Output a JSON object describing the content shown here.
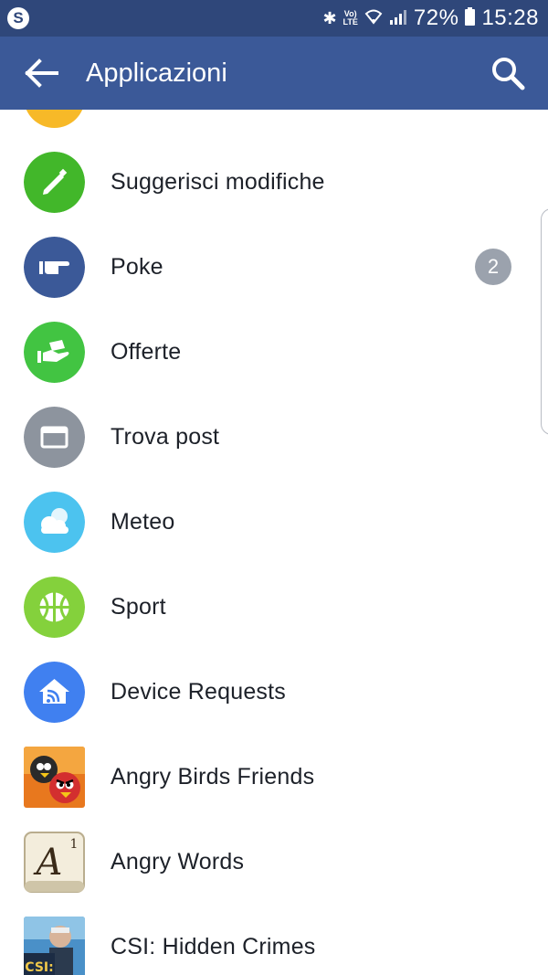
{
  "status_bar": {
    "left_icon": "skype-icon",
    "skype_glyph": "S",
    "lte_top": "Vo)",
    "lte_bottom": "LTE",
    "battery": "72%",
    "time": "15:28",
    "icons": [
      "bluetooth-icon",
      "volte-icon",
      "wifi-icon",
      "signal-icon",
      "battery-icon"
    ]
  },
  "app_bar": {
    "back_icon": "arrow-left-icon",
    "title": "Applicazioni",
    "search_icon": "search-icon"
  },
  "colors": {
    "status_bar": "#2f477a",
    "app_bar": "#3b5998",
    "text": "#1d2129",
    "badge": "#9ba2ad"
  },
  "list": {
    "items": [
      {
        "label": "Suggerisci modifiche",
        "icon": "pencil-icon",
        "color": "#42b72a"
      },
      {
        "label": "Poke",
        "icon": "poke-hand-icon",
        "color": "#3b5998",
        "badge": "2"
      },
      {
        "label": "Offerte",
        "icon": "offer-hand-icon",
        "color": "#42c442"
      },
      {
        "label": "Trova post",
        "icon": "browser-window-icon",
        "color": "#8d949e"
      },
      {
        "label": "Meteo",
        "icon": "cloud-icon",
        "color": "#4cc3ef"
      },
      {
        "label": "Sport",
        "icon": "ball-icon",
        "color": "#84d13c"
      },
      {
        "label": "Device Requests",
        "icon": "home-signal-icon",
        "color": "#4080f0"
      },
      {
        "label": "Angry Birds Friends",
        "icon": "angry-birds-icon"
      },
      {
        "label": "Angry Words",
        "icon": "angry-words-icon",
        "tile_letter": "A",
        "tile_value": "1"
      },
      {
        "label": "CSI: Hidden Crimes",
        "icon": "csi-icon",
        "tile_text": "CSI:"
      }
    ]
  }
}
